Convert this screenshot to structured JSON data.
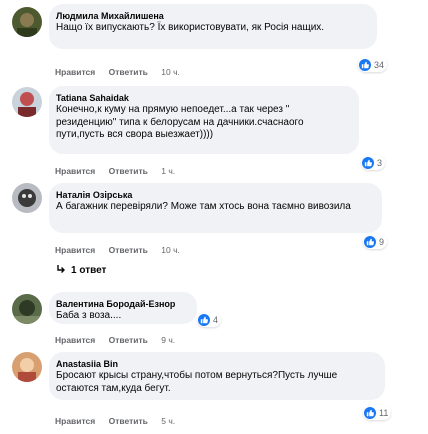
{
  "comments": [
    {
      "author": "Людмила Михайлишена",
      "text": "Нащо їх випускають? Їх використовувати, як Росія нащих.",
      "like_label": "Нравится",
      "reply_label": "Ответить",
      "time": "10 ч.",
      "reactions": "34"
    },
    {
      "author": "Tatiana Sahaidak",
      "text": "Конечно,к куму на прямую непоедет...а так через \" резиденцию\" типа к белорусам на дачники.счаснаого пути,пусть вся свора выезжает))))",
      "like_label": "Нравится",
      "reply_label": "Ответить",
      "time": "1 ч.",
      "reactions": "3"
    },
    {
      "author": "Наталія Озірська",
      "text": "А багажник перевіряли? Може там хтось вона таємно вивозила",
      "like_label": "Нравится",
      "reply_label": "Ответить",
      "time": "10 ч.",
      "reactions": "9"
    },
    {
      "author": "Валентина Бородай-Езнор",
      "text": "Баба з воза....",
      "like_label": "Нравится",
      "reply_label": "Ответить",
      "time": "9 ч.",
      "reactions": "4"
    },
    {
      "author": "Anastasiia Bin",
      "text": "Бросают крысы страну,чтобы потом вернуться?Пусть лучше остаются там,куда бегут.",
      "like_label": "Нравится",
      "reply_label": "Ответить",
      "time": "5 ч.",
      "reactions": "11"
    }
  ],
  "replies_link": "1 ответ",
  "colors": {
    "like_blue": "#1877f2",
    "bubble_bg": "#f0f2f5",
    "meta_gray": "#65676b"
  }
}
